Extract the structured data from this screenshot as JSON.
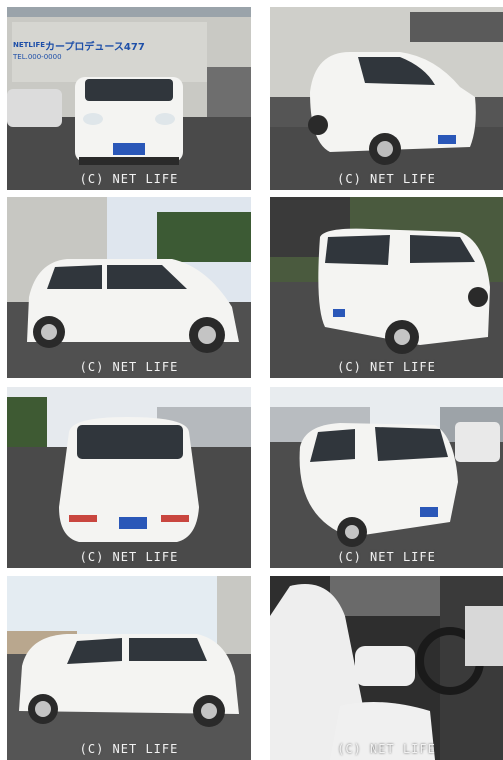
{
  "watermark": "(C) NET LIFE",
  "sign": {
    "brand": "NETLIFE",
    "name": "カープロデュース477",
    "phone": "TEL.000-0000"
  },
  "photos": [
    {
      "view": "front"
    },
    {
      "view": "front-three-quarter"
    },
    {
      "view": "side"
    },
    {
      "view": "rear-three-quarter"
    },
    {
      "view": "rear"
    },
    {
      "view": "rear-three-quarter"
    },
    {
      "view": "side"
    },
    {
      "view": "interior"
    }
  ],
  "colors": {
    "car_body": "#f4f4f2",
    "plate": "#2a57b8",
    "sky": "#dfe6ee",
    "asphalt": "#4a4a4a"
  }
}
